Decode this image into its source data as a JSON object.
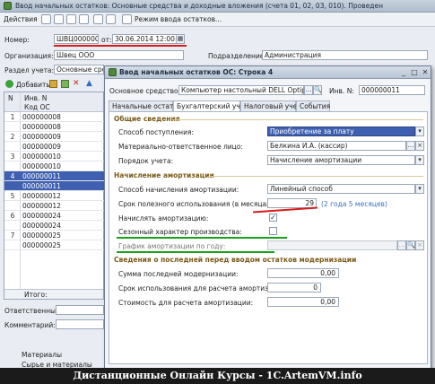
{
  "main": {
    "title": "Ввод начальных остатков: Основные средства и доходные вложения (счета 01, 02, 03, 010). Проведен",
    "toolbar": {
      "actions": "Действия",
      "mode": "Режим ввода остатков..."
    },
    "number_label": "Номер:",
    "number_value": "ШВЦ00000014",
    "date_label": "от:",
    "date_value": "30.06.2014 12:00:14",
    "org_label": "Организация:",
    "org_value": "Швец ООО",
    "dept_label": "Подразделение:",
    "dept_value": "Администрация",
    "section_label": "Раздел учета:",
    "section_value": "Основные средс",
    "add_button": "Добавить",
    "grid": {
      "col_n": "N",
      "col_inv": "Инв. N",
      "col_code": "Код ОС",
      "rows": [
        {
          "n": "1",
          "v": "000000008"
        },
        {
          "n": "",
          "v": "000000008"
        },
        {
          "n": "2",
          "v": "000000009"
        },
        {
          "n": "",
          "v": "000000009"
        },
        {
          "n": "3",
          "v": "000000010"
        },
        {
          "n": "",
          "v": "000000010"
        },
        {
          "n": "4",
          "v": "000000011"
        },
        {
          "n": "",
          "v": "000000011"
        },
        {
          "n": "5",
          "v": "000000012"
        },
        {
          "n": "",
          "v": "000000012"
        },
        {
          "n": "6",
          "v": "000000024"
        },
        {
          "n": "",
          "v": "000000024"
        },
        {
          "n": "7",
          "v": "000000025"
        },
        {
          "n": "",
          "v": "000000025"
        }
      ],
      "total": "Итого:"
    },
    "responsible_label": "Ответственный:",
    "comment_label": "Комментарий:",
    "bottom_items": [
      "Материалы",
      "Сырье и материалы"
    ]
  },
  "dialog": {
    "title": "Ввод начальных остатков ОС: Строка 4",
    "os_label": "Основное средство:",
    "os_value": "Компьютер настольный DELL Optiplex",
    "inv_label": "Инв. N:",
    "inv_value": "000000011",
    "tabs": [
      "Начальные остатки",
      "Бухгалтерский учет",
      "Налоговый учет",
      "События"
    ],
    "general_section": "Общие сведения",
    "receipt_label": "Способ поступления:",
    "receipt_value": "Приобретение за плату",
    "mol_label": "Материально-ответственное лицо:",
    "mol_value": "Белкина И.А. (кассир)",
    "accounting_order_label": "Порядок учета:",
    "accounting_order_value": "Начисление амортизации",
    "amort_section": "Начисление амортизации",
    "method_label": "Способ начисления амортизации:",
    "method_value": "Линейный способ",
    "life_label": "Срок полезного использования (в месяцах):",
    "life_value": "29",
    "life_hint": "(2 года 5 месяцев)",
    "charge_label": "Начислять амортизацию:",
    "seasonal_label": "Сезонный характер производства:",
    "schedule_label": "График амортизации по году:",
    "modern_section": "Сведения о последней перед вводом остатков модернизации",
    "last_sum_label": "Сумма последней модернизации:",
    "last_sum_value": "0,00",
    "term_label": "Срок использования для расчета амортизации:",
    "term_value": "0",
    "cost_label": "Стоимость для расчета амортизации:",
    "cost_value": "0,00"
  },
  "footer": "Дистанционные Онлайн Курсы - 1C.ArtemVM.info",
  "colors": {
    "selection": "#3f5fb0",
    "red_mark": "#d81b1b",
    "green_mark": "#17a317",
    "section": "#7a5a18"
  }
}
